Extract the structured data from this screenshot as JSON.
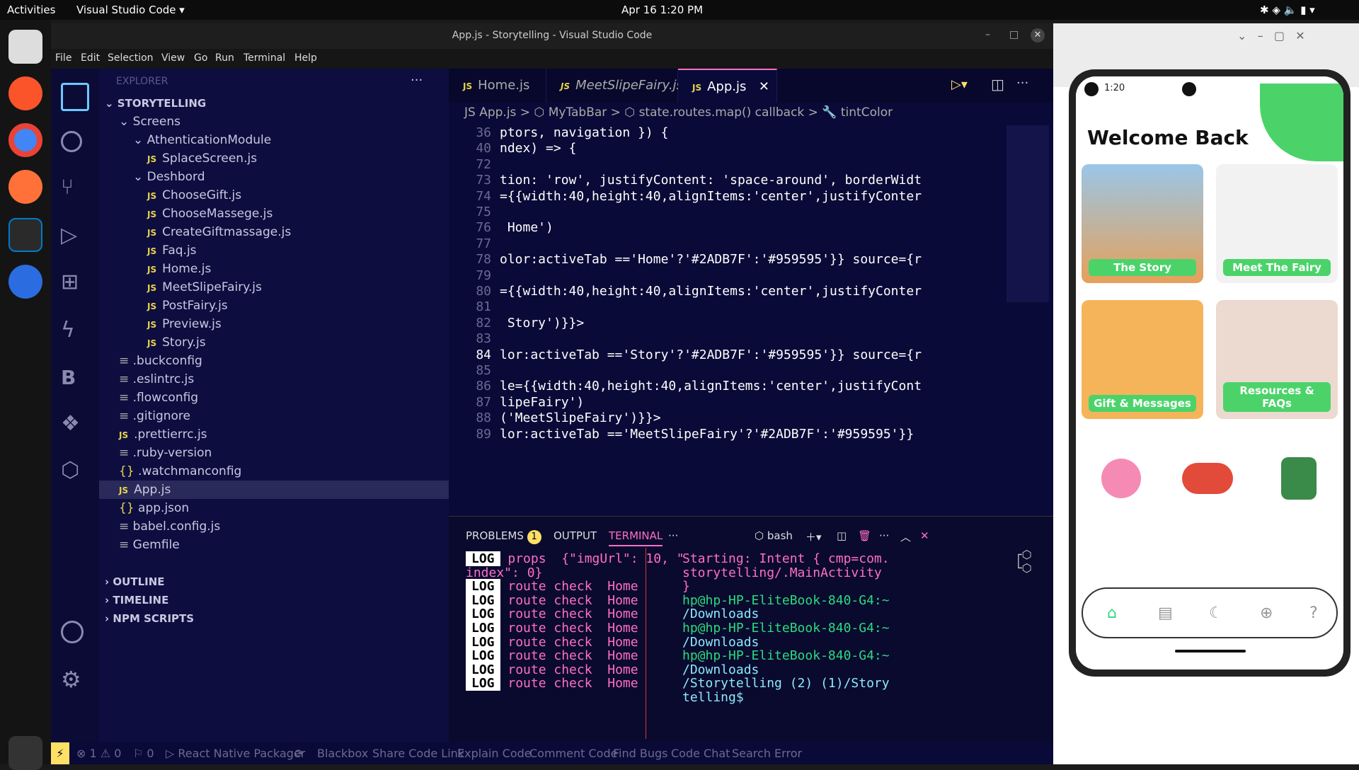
{
  "topbar": {
    "activities": "Activities",
    "app": "Visual Studio Code",
    "clock": "Apr 16  1:20 PM"
  },
  "window": {
    "title": "App.js - Storytelling - Visual Studio Code"
  },
  "menu": [
    "File",
    "Edit",
    "Selection",
    "View",
    "Go",
    "Run",
    "Terminal",
    "Help"
  ],
  "explorer": {
    "header": "EXPLORER",
    "root": "STORYTELLING",
    "items": [
      {
        "label": "Screens",
        "type": "folder",
        "indent": 1
      },
      {
        "label": "AthenticationModule",
        "type": "folder",
        "indent": 2
      },
      {
        "label": "SplaceScreen.js",
        "type": "js",
        "indent": 3
      },
      {
        "label": "Deshbord",
        "type": "folder",
        "indent": 2
      },
      {
        "label": "ChooseGift.js",
        "type": "js",
        "indent": 3
      },
      {
        "label": "ChooseMassege.js",
        "type": "js",
        "indent": 3
      },
      {
        "label": "CreateGiftmassage.js",
        "type": "js",
        "indent": 3
      },
      {
        "label": "Faq.js",
        "type": "js",
        "indent": 3
      },
      {
        "label": "Home.js",
        "type": "js",
        "indent": 3
      },
      {
        "label": "MeetSlipeFairy.js",
        "type": "js",
        "indent": 3
      },
      {
        "label": "PostFairy.js",
        "type": "js",
        "indent": 3
      },
      {
        "label": "Preview.js",
        "type": "js",
        "indent": 3
      },
      {
        "label": "Story.js",
        "type": "js",
        "indent": 3
      },
      {
        "label": ".buckconfig",
        "type": "cfg",
        "indent": 1
      },
      {
        "label": ".eslintrc.js",
        "type": "cfg",
        "indent": 1
      },
      {
        "label": ".flowconfig",
        "type": "cfg",
        "indent": 1
      },
      {
        "label": ".gitignore",
        "type": "cfg",
        "indent": 1
      },
      {
        "label": ".prettierrc.js",
        "type": "js",
        "indent": 1
      },
      {
        "label": ".ruby-version",
        "type": "cfg",
        "indent": 1
      },
      {
        "label": ".watchmanconfig",
        "type": "json",
        "indent": 1
      },
      {
        "label": "App.js",
        "type": "js",
        "indent": 1
      },
      {
        "label": "app.json",
        "type": "json",
        "indent": 1
      },
      {
        "label": "babel.config.js",
        "type": "cfg",
        "indent": 1
      },
      {
        "label": "Gemfile",
        "type": "cfg",
        "indent": 1
      }
    ],
    "sections": [
      "OUTLINE",
      "TIMELINE",
      "NPM SCRIPTS"
    ]
  },
  "tabs": [
    "Home.js",
    "MeetSlipeFairy.js",
    "App.js"
  ],
  "breadcrumb": "JS App.js  >  ⬡ MyTabBar  >  ⬡ state.routes.map() callback  >  🔧 tintColor",
  "code": [
    {
      "n": "36",
      "t": "ptors, navigation }) {"
    },
    {
      "n": "40",
      "t": "ndex) => {"
    },
    {
      "n": "72",
      "t": ""
    },
    {
      "n": "73",
      "t": "tion: 'row', justifyContent: 'space-around', borderWidt"
    },
    {
      "n": "74",
      "t": "={{width:40,height:40,alignItems:'center',justifyConter"
    },
    {
      "n": "75",
      "t": ""
    },
    {
      "n": "76",
      "t": " Home')"
    },
    {
      "n": "77",
      "t": ""
    },
    {
      "n": "78",
      "t": "olor:activeTab =='Home'?'#2ADB7F':'#959595'}} source={r"
    },
    {
      "n": "79",
      "t": ""
    },
    {
      "n": "80",
      "t": "={{width:40,height:40,alignItems:'center',justifyConter"
    },
    {
      "n": "81",
      "t": ""
    },
    {
      "n": "82",
      "t": " Story')}}>"
    },
    {
      "n": "83",
      "t": ""
    },
    {
      "n": "84",
      "t": "lor:activeTab =='Story'?'#2ADB7F':'#959595'}} source={r"
    },
    {
      "n": "85",
      "t": ""
    },
    {
      "n": "86",
      "t": "le={{width:40,height:40,alignItems:'center',justifyCont"
    },
    {
      "n": "87",
      "t": "lipeFairy')"
    },
    {
      "n": "88",
      "t": "('MeetSlipeFairy')}}>"
    },
    {
      "n": "89",
      "t": "lor:activeTab =='MeetSlipeFairy'?'#2ADB7F':'#959595'}}"
    }
  ],
  "panel": {
    "tabs": [
      "PROBLEMS",
      "OUTPUT",
      "TERMINAL"
    ],
    "badge": "1",
    "shell": "bash"
  },
  "logs": [
    {
      "tag": "LOG",
      "text": " props  {\"imgUrl\": 10, \""
    },
    {
      "tag": "",
      "text": "index\": 0}"
    },
    {
      "tag": "LOG",
      "text": " route check  Home"
    },
    {
      "tag": "LOG",
      "text": " route check  Home"
    },
    {
      "tag": "LOG",
      "text": " route check  Home"
    },
    {
      "tag": "LOG",
      "text": " route check  Home"
    },
    {
      "tag": "LOG",
      "text": " route check  Home"
    },
    {
      "tag": "LOG",
      "text": " route check  Home"
    },
    {
      "tag": "LOG",
      "text": " route check  Home"
    },
    {
      "tag": "LOG",
      "text": " route check  Home"
    }
  ],
  "term": [
    {
      "t": "Starting: Intent { cmp=com.",
      "c": "#ff6ec7"
    },
    {
      "t": "storytelling/.MainActivity",
      "c": "#ff6ec7"
    },
    {
      "t": "}",
      "c": "#ff6ec7"
    },
    {
      "t": "hp@hp-HP-EliteBook-840-G4:~",
      "c": "#2adb7f"
    },
    {
      "t": "/Downloads",
      "c": "#8be9fd"
    },
    {
      "t": "hp@hp-HP-EliteBook-840-G4:~",
      "c": "#2adb7f"
    },
    {
      "t": "/Downloads",
      "c": "#8be9fd"
    },
    {
      "t": "hp@hp-HP-EliteBook-840-G4:~",
      "c": "#2adb7f"
    },
    {
      "t": "/Downloads",
      "c": "#8be9fd"
    },
    {
      "t": "/Storytelling (2) (1)/Story",
      "c": "#8be9fd"
    },
    {
      "t": "telling$",
      "c": "#8be9fd"
    }
  ],
  "status": [
    "⊗ 1 ⚠ 0",
    "⚐ 0",
    "▷ React Native Packager",
    "⟳",
    "Blackbox",
    "Share Code Link",
    "Explain Code",
    "Comment Code",
    "Find Bugs",
    "Code Chat",
    "Search Error"
  ],
  "phone": {
    "time": "1:20",
    "title": "Welcome Back",
    "cards": [
      "The Story",
      "Meet The Fairy",
      "Gift & Messages",
      "Resources & FAQs"
    ]
  }
}
